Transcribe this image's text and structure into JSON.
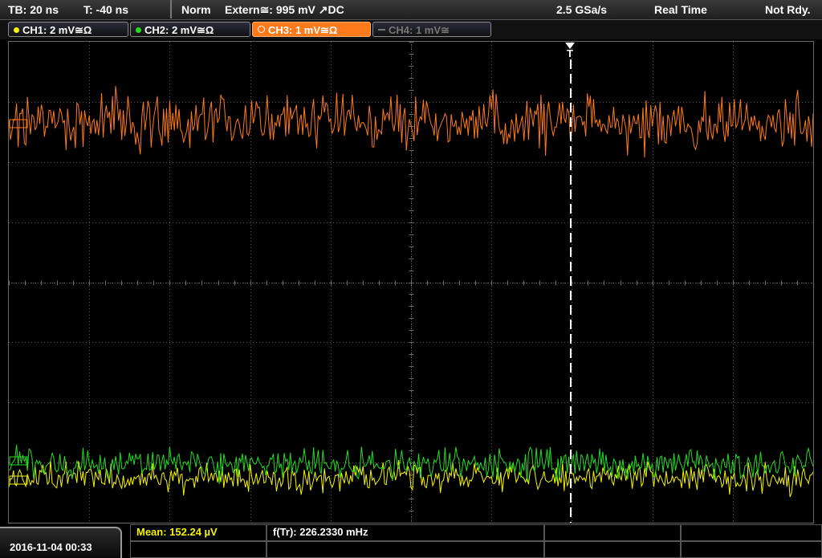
{
  "status": {
    "timebase": "TB: 20 ns",
    "trigger_time": "T: -40 ns",
    "mode": "Norm",
    "trigger_source": "Extern≅: 995 mV ↗DC",
    "sample_rate": "2.5 GSa/s",
    "acq_mode": "Real Time",
    "state": "Not Rdy."
  },
  "channels": [
    {
      "label": "CH1: 2 mV≅Ω",
      "color": "#f5f500",
      "active": true
    },
    {
      "label": "CH2: 2 mV≅Ω",
      "color": "#22dd22",
      "active": true
    },
    {
      "label": "CH3: 1 mV≅Ω",
      "color": "#ff7a1a",
      "active": true,
      "selected": true
    },
    {
      "label": "CH4: 1 mV≅",
      "color": "#777777",
      "active": false
    }
  ],
  "footer": {
    "datetime": "2016-11-04 00:33",
    "measurement_1": "Mean: 152.24 µV",
    "measurement_2": "f(Tr): 226.2330 mHz"
  },
  "trigger_marker": "T",
  "colors": {
    "ch1": "#f5f500",
    "ch2": "#22dd22",
    "ch3": "#ff7a1a",
    "grid": "#5a5a5a"
  }
}
